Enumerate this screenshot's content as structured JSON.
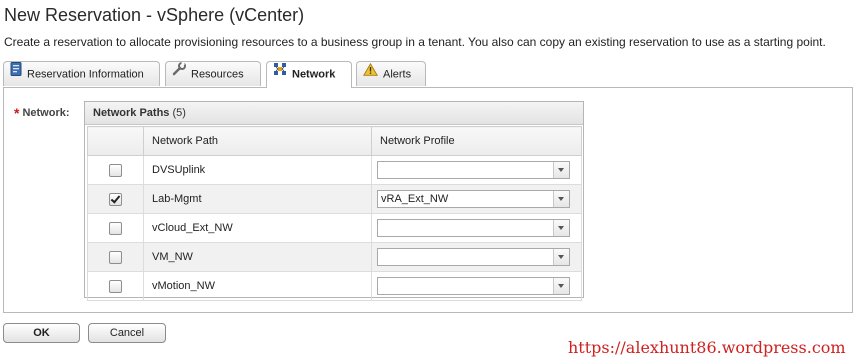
{
  "page": {
    "title": "New Reservation - vSphere (vCenter)",
    "subtitle": "Create a reservation to allocate provisioning resources to a business group in a tenant. You also can copy an existing reservation to use as a starting point."
  },
  "tabs": [
    {
      "label": "Reservation Information",
      "icon": "document-icon",
      "active": false
    },
    {
      "label": "Resources",
      "icon": "wrench-icon",
      "active": false
    },
    {
      "label": "Network",
      "icon": "network-icon",
      "active": true
    },
    {
      "label": "Alerts",
      "icon": "warning-icon",
      "active": false
    }
  ],
  "network": {
    "required_mark": "*",
    "field_label": "Network:",
    "box_title": "Network Paths",
    "box_count": "(5)",
    "columns": {
      "path": "Network Path",
      "profile": "Network Profile"
    },
    "rows": [
      {
        "checked": false,
        "path": "DVSUplink",
        "profile": ""
      },
      {
        "checked": true,
        "path": "Lab-Mgmt",
        "profile": "vRA_Ext_NW"
      },
      {
        "checked": false,
        "path": "vCloud_Ext_NW",
        "profile": ""
      },
      {
        "checked": false,
        "path": "VM_NW",
        "profile": ""
      },
      {
        "checked": false,
        "path": "vMotion_NW",
        "profile": ""
      }
    ]
  },
  "buttons": {
    "ok": "OK",
    "cancel": "Cancel"
  },
  "watermark": "https://alexhunt86.wordpress.com",
  "colors": {
    "required": "#cc1a1a",
    "watermark": "#d02020",
    "alt_row": "#f1f1f1"
  }
}
